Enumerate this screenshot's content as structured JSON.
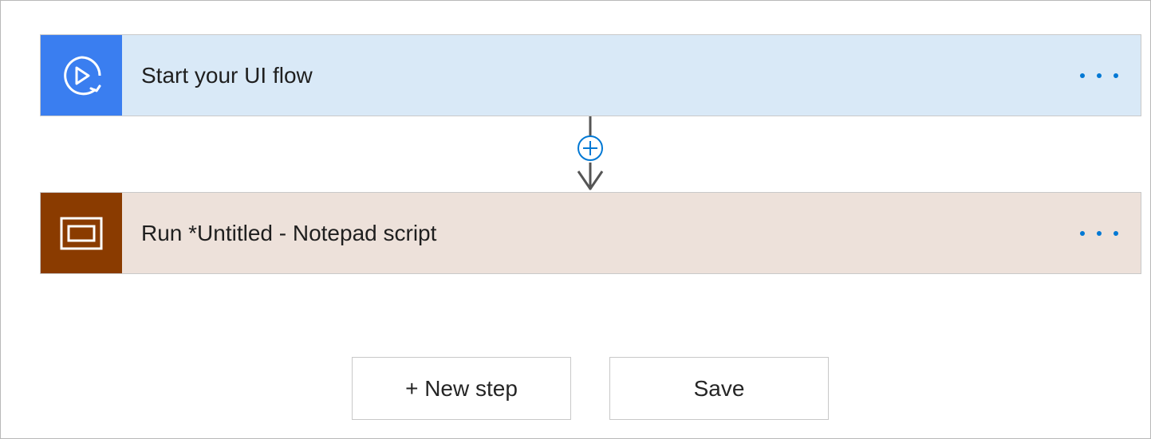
{
  "steps": [
    {
      "title": "Start your UI flow",
      "icon": "play-refresh-icon",
      "icon_bg": "#3a7ef0",
      "card_bg": "#d9e9f7"
    },
    {
      "title": "Run *Untitled - Notepad script",
      "icon": "window-screen-icon",
      "icon_bg": "#8a3b00",
      "card_bg": "#ede1da"
    }
  ],
  "more_icon": "ellipsis-icon",
  "connector_icon": "plus-circle-icon",
  "buttons": {
    "new_step": "+ New step",
    "save": "Save"
  },
  "colors": {
    "accent": "#0078d4"
  }
}
